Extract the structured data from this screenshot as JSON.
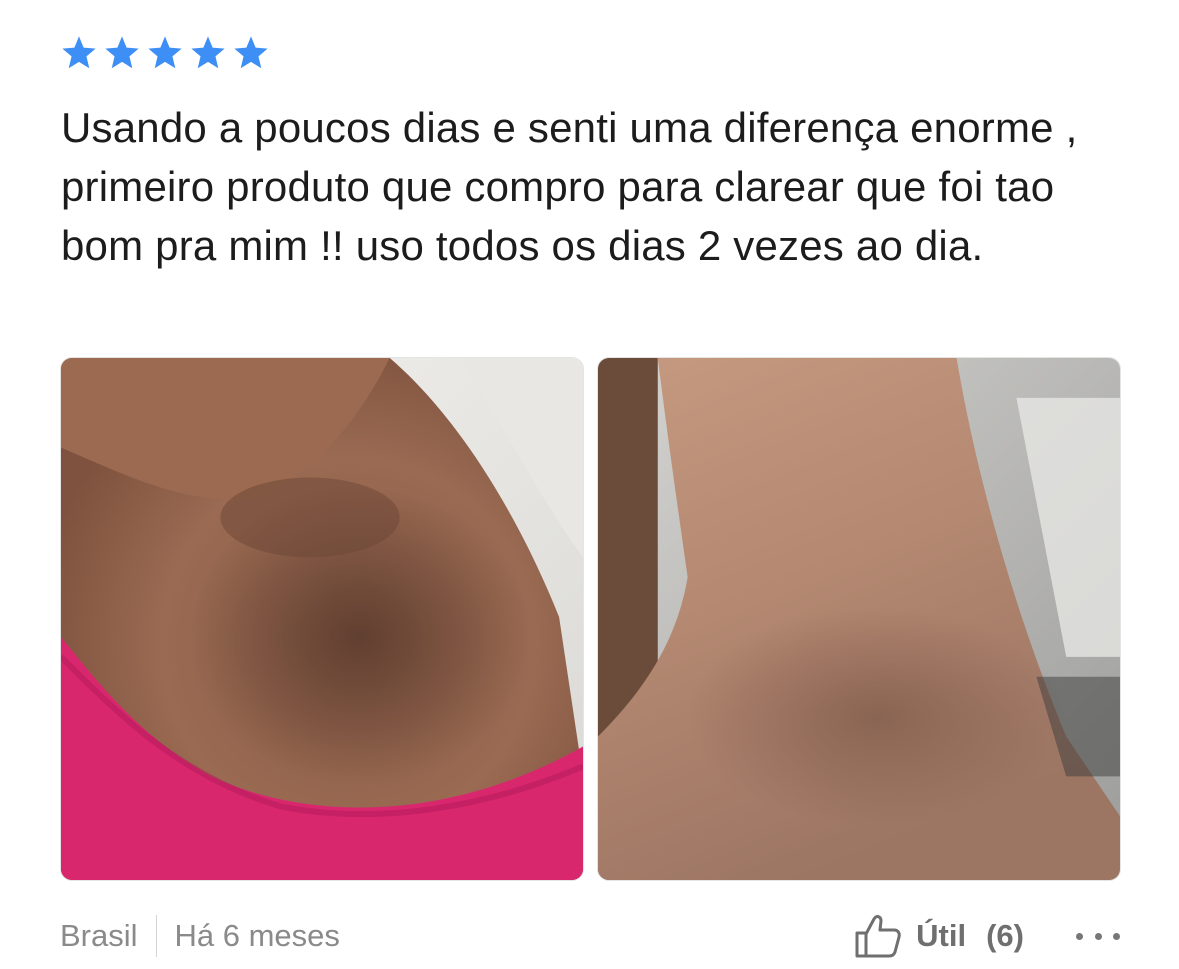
{
  "review": {
    "rating": 5,
    "rating_max": 5,
    "star_color": "#3d8ef5",
    "text": "Usando a poucos dias e senti uma diferença enorme , primeiro produto que compro para clarear que foi tao bom pra mim !! uso todos os dias 2 vezes ao dia.",
    "photos": [
      {
        "icon": "review-photo-before"
      },
      {
        "icon": "review-photo-after"
      }
    ]
  },
  "footer": {
    "country": "Brasil",
    "time_ago": "Há 6 meses",
    "helpful_label": "Útil",
    "helpful_count": "(6)"
  },
  "icons": {
    "thumbs_up": "thumbs-up-icon",
    "more": "more-options-icon"
  }
}
